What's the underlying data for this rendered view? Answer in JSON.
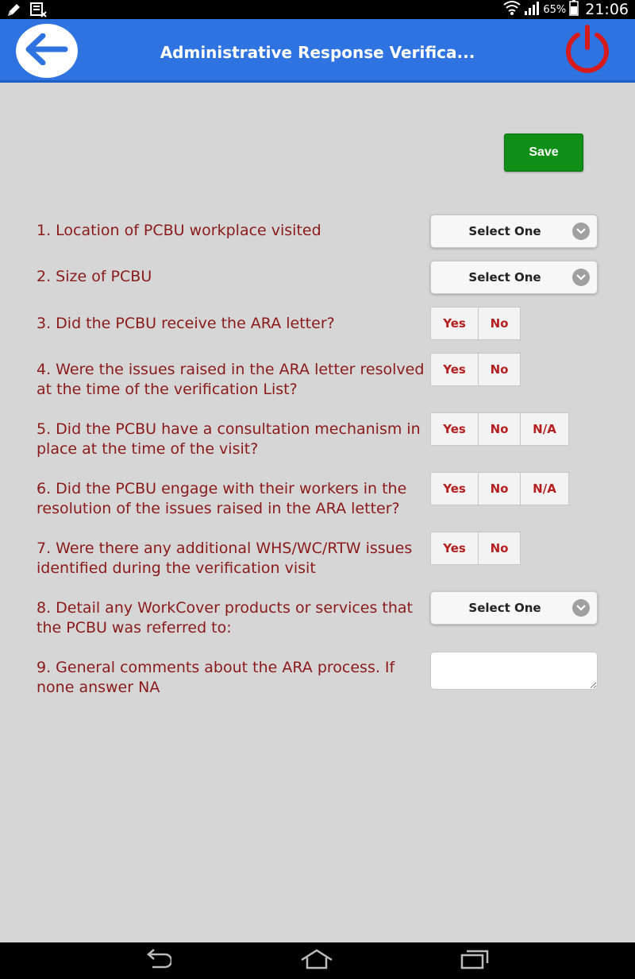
{
  "status_bar": {
    "battery_pct": "65%",
    "time": "21:06",
    "icons": [
      "pen-icon",
      "notification-icon",
      "wifi-icon",
      "signal-icon",
      "battery-icon"
    ]
  },
  "header": {
    "title": "Administrative Response Verifica...",
    "back_icon": "arrow-left-icon",
    "power_icon": "power-icon",
    "accent_color": "#2f73e0"
  },
  "save_label": "Save",
  "questions": [
    {
      "label": "1. Location of PCBU workplace visited",
      "type": "select",
      "value": "Select One"
    },
    {
      "label": "2. Size of PCBU",
      "type": "select",
      "value": "Select One"
    },
    {
      "label": "3. Did the PCBU receive the ARA letter?",
      "type": "segmented",
      "options": [
        "Yes",
        "No"
      ]
    },
    {
      "label": "4. Were the issues raised in the ARA letter resolved at the time of the verification List?",
      "type": "segmented",
      "options": [
        "Yes",
        "No"
      ]
    },
    {
      "label": "5. Did the PCBU have a consultation mechanism in place at the time of the visit?",
      "type": "segmented",
      "options": [
        "Yes",
        "No",
        "N/A"
      ]
    },
    {
      "label": "6. Did the PCBU engage with their workers in the resolution of the issues raised in the ARA letter?",
      "type": "segmented",
      "options": [
        "Yes",
        "No",
        "N/A"
      ]
    },
    {
      "label": "7. Were there any additional WHS/WC/RTW issues identified during the verification visit",
      "type": "segmented",
      "options": [
        "Yes",
        "No"
      ]
    },
    {
      "label": "8. Detail any WorkCover products or services that the PCBU was referred to:",
      "type": "select",
      "value": "Select One"
    },
    {
      "label": "9. General comments about the ARA process. If none answer NA",
      "type": "textarea",
      "value": ""
    }
  ],
  "nav_bar": [
    "back-icon",
    "home-icon",
    "recent-apps-icon"
  ],
  "colors": {
    "label": "#8b1a1a",
    "option": "#b51f1f",
    "save": "#108f17",
    "background": "#d6d6d6"
  }
}
